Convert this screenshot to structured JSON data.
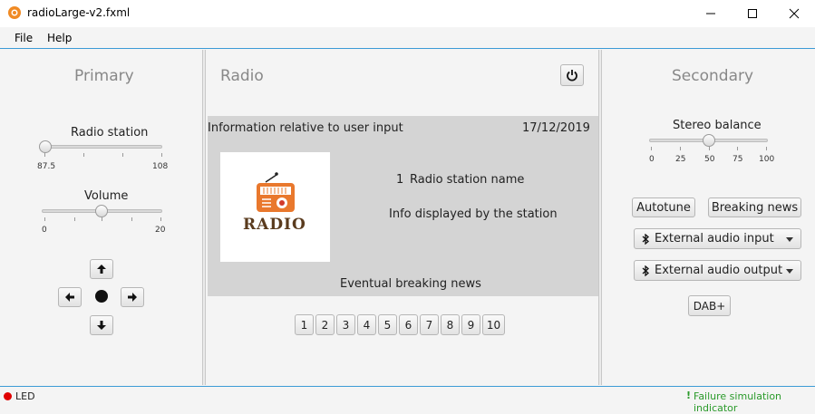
{
  "window": {
    "title": "radioLarge-v2.fxml"
  },
  "menu": {
    "file": "File",
    "help": "Help"
  },
  "primary": {
    "title": "Primary",
    "station_label": "Radio station",
    "station_min": "87.5",
    "station_max": "108",
    "station_value": 87.5,
    "volume_label": "Volume",
    "volume_min": "0",
    "volume_max": "20",
    "volume_value": 10
  },
  "radio": {
    "title": "Radio",
    "info_text": "Information relative to user input",
    "date": "17/12/2019",
    "logo_text": "RADIO",
    "station_number": "1",
    "station_name": "Radio station name",
    "station_info": "Info displayed by the station",
    "breaking_news": "Eventual breaking news",
    "pages": [
      "1",
      "2",
      "3",
      "4",
      "5",
      "6",
      "7",
      "8",
      "9",
      "10"
    ]
  },
  "secondary": {
    "title": "Secondary",
    "balance_label": "Stereo balance",
    "balance_ticks": [
      "0",
      "25",
      "50",
      "75",
      "100"
    ],
    "balance_value": 50,
    "autotune": "Autotune",
    "breaking_news": "Breaking news",
    "audio_input": "External audio input",
    "audio_output": "External audio output",
    "dab": "DAB+"
  },
  "status": {
    "led": "LED",
    "failure": "Failure simulation indicator",
    "led_color": "#e00000",
    "failure_color": "#2a9a2a"
  }
}
